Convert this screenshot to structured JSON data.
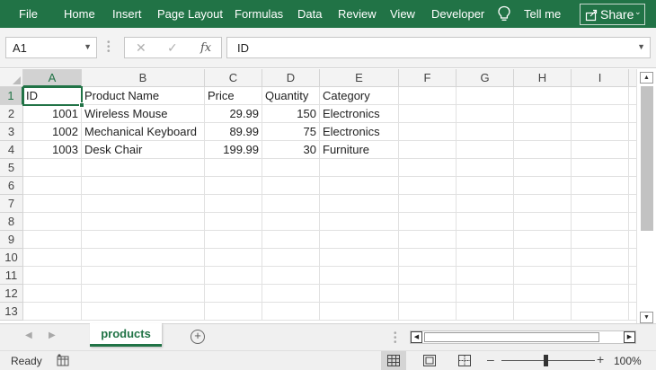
{
  "ribbon": {
    "tabs": [
      "File",
      "Home",
      "Insert",
      "Page Layout",
      "Formulas",
      "Data",
      "Review",
      "View",
      "Developer"
    ],
    "tell_me": "Tell me",
    "share": "Share",
    "color": "#217346"
  },
  "formula_bar": {
    "name_box": "A1",
    "fx_label": "fx",
    "formula": "ID"
  },
  "sheet": {
    "columns": [
      "A",
      "B",
      "C",
      "D",
      "E",
      "F",
      "G",
      "H",
      "I"
    ],
    "row_numbers": [
      "1",
      "2",
      "3",
      "4",
      "5",
      "6",
      "7",
      "8",
      "9",
      "10",
      "11",
      "12",
      "13"
    ],
    "header_row": [
      "ID",
      "Product Name",
      "Price",
      "Quantity",
      "Category"
    ],
    "rows": [
      [
        "1001",
        "Wireless Mouse",
        "29.99",
        "150",
        "Electronics"
      ],
      [
        "1002",
        "Mechanical Keyboard",
        "89.99",
        "75",
        "Electronics"
      ],
      [
        "1003",
        "Desk Chair",
        "199.99",
        "30",
        "Furniture"
      ]
    ],
    "active_cell": "A1"
  },
  "tabs": {
    "active_sheet": "products",
    "add_symbol": "+"
  },
  "status": {
    "ready": "Ready",
    "zoom": "100%"
  }
}
